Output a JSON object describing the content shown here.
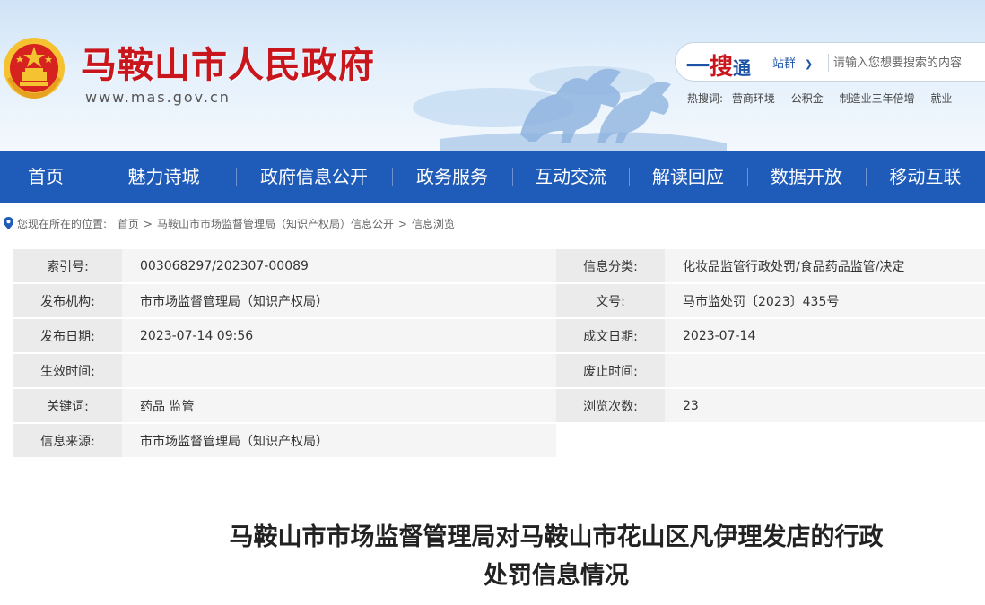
{
  "header": {
    "site_title": "马鞍山市人民政府",
    "site_url": "www.mas.gov.cn",
    "brand_red": "#c9161d",
    "brand_blue": "#1f5bb8"
  },
  "search": {
    "logo_part1": "一",
    "logo_part2": "搜",
    "logo_part3": "通",
    "scope": "站群",
    "placeholder": "请输入您想要搜索的内容",
    "hot_label": "热搜词:",
    "hot_words": [
      "营商环境",
      "公积金",
      "制造业三年倍增",
      "就业"
    ]
  },
  "nav": {
    "items": [
      "首页",
      "魅力诗城",
      "政府信息公开",
      "政务服务",
      "互动交流",
      "解读回应",
      "数据开放",
      "移动互联"
    ]
  },
  "breadcrumb": {
    "prefix": "您现在所在的位置:",
    "items": [
      "首页",
      "马鞍山市市场监督管理局（知识产权局）信息公开",
      "信息浏览"
    ],
    "separator": ">"
  },
  "info": {
    "index_no_label": "索引号:",
    "index_no": "003068297/202307-00089",
    "category_label": "信息分类:",
    "category": "化妆品监管行政处罚/食品药品监管/决定",
    "publisher_label": "发布机构:",
    "publisher": "市市场监督管理局（知识产权局）",
    "doc_no_label": "文号:",
    "doc_no": "马市监处罚〔2023〕435号",
    "publish_date_label": "发布日期:",
    "publish_date": "2023-07-14 09:56",
    "created_date_label": "成文日期:",
    "created_date": "2023-07-14",
    "effective_label": "生效时间:",
    "effective": "",
    "expire_label": "废止时间:",
    "expire": "",
    "keywords_label": "关键词:",
    "keywords": "药品 监管",
    "views_label": "浏览次数:",
    "views": "23",
    "source_label": "信息来源:",
    "source": "市市场监督管理局（知识产权局）"
  },
  "article": {
    "title_line1": "马鞍山市市场监督管理局对马鞍山市花山区凡伊理发店的行政",
    "title_line2": "处罚信息情况"
  }
}
